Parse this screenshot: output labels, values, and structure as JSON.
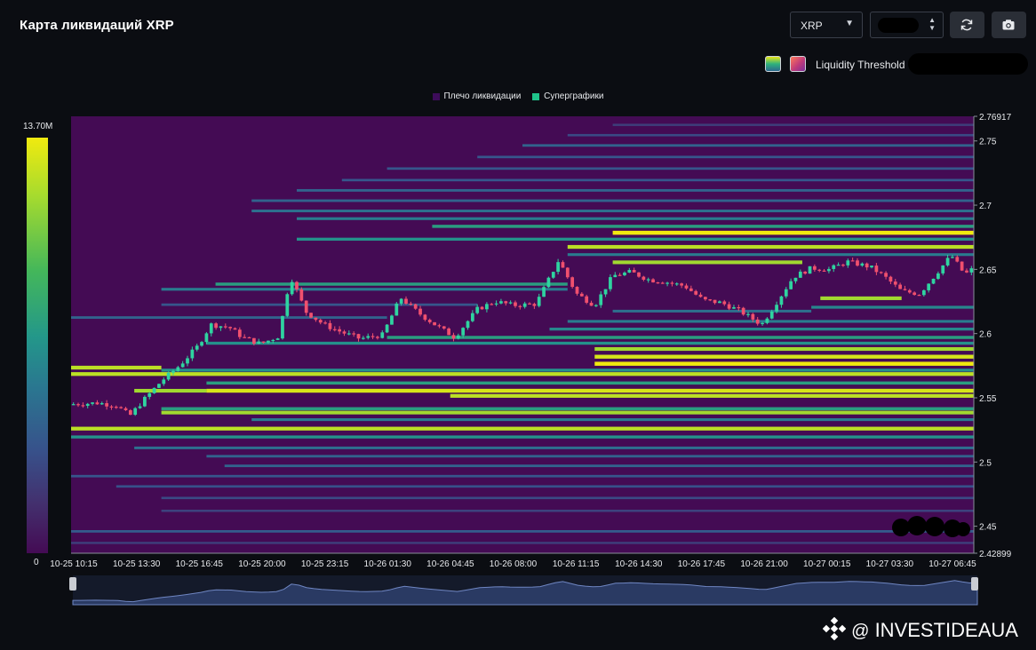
{
  "header": {
    "title": "Карта ликвидаций XRP"
  },
  "controls": {
    "coin_select": {
      "value": "XRP"
    },
    "refresh_icon": "refresh-icon",
    "camera_icon": "camera-icon"
  },
  "threshold": {
    "label": "Liquidity Threshold"
  },
  "colorbar": {
    "max_label": "13.70M",
    "min_label": "0"
  },
  "watermark": {
    "text": "INVESTIDEAUA",
    "at": "@"
  },
  "chart_data": {
    "type": "heatmap",
    "title": "Карта ликвидаций XRP",
    "legend": [
      "Плечо ликвидации",
      "Суперграфики"
    ],
    "legend_colors": [
      "#3d0c5a",
      "#1fc38a"
    ],
    "legend_position": "top-center",
    "y_range": [
      2.42899,
      2.76917
    ],
    "y_ticks": [
      "2.76917",
      "2.75",
      "2.7",
      "2.65",
      "2.6",
      "2.55",
      "2.5",
      "2.45",
      "2.42899"
    ],
    "x_ticks": [
      "10-25 10:15",
      "10-25 13:30",
      "10-25 16:45",
      "10-25 20:00",
      "10-25 23:15",
      "10-26 01:30",
      "10-26 04:45",
      "10-26 08:00",
      "10-26 11:15",
      "10-26 14:30",
      "10-26 17:45",
      "10-26 21:00",
      "10-27 00:15",
      "10-27 03:30",
      "10-27 06:45"
    ],
    "colorscale": {
      "min": 0,
      "max": 13700000,
      "max_label": "13.70M",
      "colors": [
        "#440b54",
        "#43306e",
        "#37528b",
        "#2a7790",
        "#23978a",
        "#44b75a",
        "#a6db2e",
        "#f0ea0f"
      ]
    },
    "background_color": "#440b54",
    "candle_colors": {
      "up": "#2fd3a0",
      "down": "#f0506e"
    },
    "price_path": [
      [
        0,
        2.545
      ],
      [
        0.03,
        2.546
      ],
      [
        0.05,
        2.544
      ],
      [
        0.065,
        2.536
      ],
      [
        0.08,
        2.548
      ],
      [
        0.1,
        2.563
      ],
      [
        0.12,
        2.575
      ],
      [
        0.14,
        2.59
      ],
      [
        0.155,
        2.607
      ],
      [
        0.175,
        2.605
      ],
      [
        0.19,
        2.597
      ],
      [
        0.21,
        2.592
      ],
      [
        0.23,
        2.598
      ],
      [
        0.243,
        2.645
      ],
      [
        0.26,
        2.617
      ],
      [
        0.28,
        2.607
      ],
      [
        0.3,
        2.601
      ],
      [
        0.32,
        2.596
      ],
      [
        0.345,
        2.599
      ],
      [
        0.365,
        2.628
      ],
      [
        0.385,
        2.616
      ],
      [
        0.405,
        2.606
      ],
      [
        0.425,
        2.597
      ],
      [
        0.45,
        2.619
      ],
      [
        0.47,
        2.625
      ],
      [
        0.49,
        2.622
      ],
      [
        0.515,
        2.623
      ],
      [
        0.54,
        2.657
      ],
      [
        0.56,
        2.631
      ],
      [
        0.58,
        2.622
      ],
      [
        0.6,
        2.645
      ],
      [
        0.62,
        2.648
      ],
      [
        0.64,
        2.642
      ],
      [
        0.66,
        2.64
      ],
      [
        0.68,
        2.637
      ],
      [
        0.7,
        2.626
      ],
      [
        0.72,
        2.624
      ],
      [
        0.74,
        2.618
      ],
      [
        0.765,
        2.607
      ],
      [
        0.785,
        2.628
      ],
      [
        0.8,
        2.644
      ],
      [
        0.82,
        2.651
      ],
      [
        0.84,
        2.65
      ],
      [
        0.86,
        2.656
      ],
      [
        0.885,
        2.652
      ],
      [
        0.9,
        2.645
      ],
      [
        0.92,
        2.633
      ],
      [
        0.94,
        2.631
      ],
      [
        0.96,
        2.648
      ],
      [
        0.975,
        2.661
      ],
      [
        0.99,
        2.646
      ],
      [
        1.0,
        2.651
      ]
    ],
    "liquidity_bands": [
      {
        "price": 2.5765,
        "from": 0.58,
        "to": 1.0,
        "level": 1.0
      },
      {
        "price": 2.582,
        "from": 0.58,
        "to": 1.0,
        "level": 0.95
      },
      {
        "price": 2.588,
        "from": 0.58,
        "to": 1.0,
        "level": 0.85
      },
      {
        "price": 2.5715,
        "from": 0.1,
        "to": 1.0,
        "level": 0.55
      },
      {
        "price": 2.5685,
        "from": 0.0,
        "to": 1.0,
        "level": 0.9
      },
      {
        "price": 2.5615,
        "from": 0.15,
        "to": 1.0,
        "level": 0.6
      },
      {
        "price": 2.5555,
        "from": 0.15,
        "to": 1.0,
        "level": 0.95
      },
      {
        "price": 2.5515,
        "from": 0.42,
        "to": 1.0,
        "level": 0.9
      },
      {
        "price": 2.5415,
        "from": 0.1,
        "to": 1.0,
        "level": 0.6
      },
      {
        "price": 2.5385,
        "from": 0.1,
        "to": 1.0,
        "level": 0.85
      },
      {
        "price": 2.533,
        "from": 0.2,
        "to": 1.0,
        "level": 0.45
      },
      {
        "price": 2.526,
        "from": 0.0,
        "to": 1.0,
        "level": 0.9
      },
      {
        "price": 2.5195,
        "from": 0.0,
        "to": 1.0,
        "level": 0.55
      },
      {
        "price": 2.511,
        "from": 0.07,
        "to": 1.0,
        "level": 0.4
      },
      {
        "price": 2.5045,
        "from": 0.15,
        "to": 1.0,
        "level": 0.35
      },
      {
        "price": 2.497,
        "from": 0.17,
        "to": 1.0,
        "level": 0.35
      },
      {
        "price": 2.489,
        "from": 0.0,
        "to": 1.0,
        "level": 0.3
      },
      {
        "price": 2.481,
        "from": 0.05,
        "to": 1.0,
        "level": 0.28
      },
      {
        "price": 2.472,
        "from": 0.1,
        "to": 1.0,
        "level": 0.25
      },
      {
        "price": 2.462,
        "from": 0.1,
        "to": 1.0,
        "level": 0.22
      },
      {
        "price": 2.446,
        "from": 0.0,
        "to": 1.0,
        "level": 0.32
      },
      {
        "price": 2.437,
        "from": 0.0,
        "to": 1.0,
        "level": 0.2
      },
      {
        "price": 2.5925,
        "from": 0.15,
        "to": 1.0,
        "level": 0.55
      },
      {
        "price": 2.597,
        "from": 0.35,
        "to": 1.0,
        "level": 0.6
      },
      {
        "price": 2.6035,
        "from": 0.53,
        "to": 1.0,
        "level": 0.5
      },
      {
        "price": 2.6095,
        "from": 0.55,
        "to": 1.0,
        "level": 0.45
      },
      {
        "price": 2.6175,
        "from": 0.6,
        "to": 0.82,
        "level": 0.4
      },
      {
        "price": 2.6205,
        "from": 0.82,
        "to": 1.0,
        "level": 0.5
      },
      {
        "price": 2.6275,
        "from": 0.83,
        "to": 0.92,
        "level": 0.85
      },
      {
        "price": 2.6345,
        "from": 0.1,
        "to": 0.55,
        "level": 0.45
      },
      {
        "price": 2.6385,
        "from": 0.16,
        "to": 0.55,
        "level": 0.6
      },
      {
        "price": 2.6555,
        "from": 0.6,
        "to": 0.81,
        "level": 0.85
      },
      {
        "price": 2.6615,
        "from": 0.55,
        "to": 1.0,
        "level": 0.45
      },
      {
        "price": 2.6675,
        "from": 0.55,
        "to": 1.0,
        "level": 0.9
      },
      {
        "price": 2.6735,
        "from": 0.25,
        "to": 1.0,
        "level": 0.55
      },
      {
        "price": 2.6785,
        "from": 0.6,
        "to": 1.0,
        "level": 1.0
      },
      {
        "price": 2.6835,
        "from": 0.4,
        "to": 1.0,
        "level": 0.6
      },
      {
        "price": 2.6895,
        "from": 0.25,
        "to": 1.0,
        "level": 0.45
      },
      {
        "price": 2.6955,
        "from": 0.2,
        "to": 1.0,
        "level": 0.4
      },
      {
        "price": 2.7035,
        "from": 0.2,
        "to": 1.0,
        "level": 0.35
      },
      {
        "price": 2.7115,
        "from": 0.25,
        "to": 1.0,
        "level": 0.35
      },
      {
        "price": 2.7195,
        "from": 0.3,
        "to": 1.0,
        "level": 0.3
      },
      {
        "price": 2.7285,
        "from": 0.35,
        "to": 1.0,
        "level": 0.3
      },
      {
        "price": 2.7375,
        "from": 0.45,
        "to": 1.0,
        "level": 0.3
      },
      {
        "price": 2.7465,
        "from": 0.5,
        "to": 1.0,
        "level": 0.35
      },
      {
        "price": 2.7545,
        "from": 0.55,
        "to": 1.0,
        "level": 0.25
      },
      {
        "price": 2.7625,
        "from": 0.6,
        "to": 1.0,
        "level": 0.2
      },
      {
        "price": 2.6125,
        "from": 0.0,
        "to": 0.35,
        "level": 0.35
      },
      {
        "price": 2.6225,
        "from": 0.1,
        "to": 0.45,
        "level": 0.3
      },
      {
        "price": 2.5555,
        "from": 0.07,
        "to": 0.15,
        "level": 0.85
      },
      {
        "price": 2.5735,
        "from": 0.0,
        "to": 0.1,
        "level": 0.9
      }
    ]
  }
}
